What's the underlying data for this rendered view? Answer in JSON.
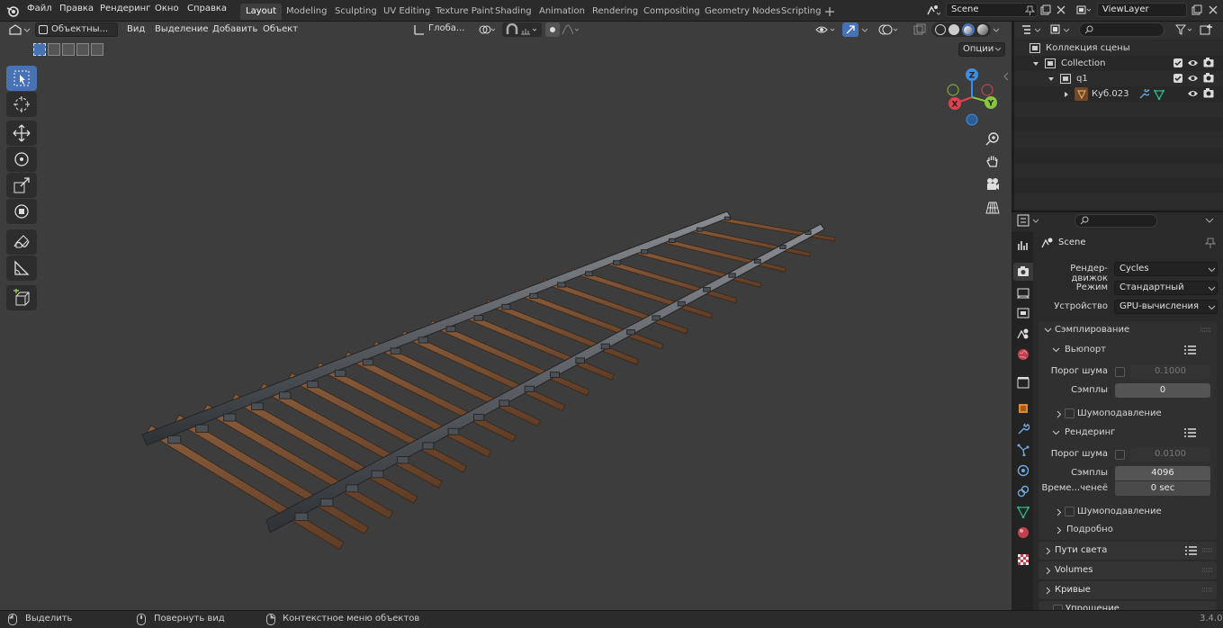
{
  "topbar": {
    "menus": [
      "Файл",
      "Правка",
      "Рендеринг",
      "Окно",
      "Справка"
    ],
    "workspaces": [
      "Layout",
      "Modeling",
      "Sculpting",
      "UV Editing",
      "Texture Paint",
      "Shading",
      "Animation",
      "Rendering",
      "Compositing",
      "Geometry Nodes",
      "Scripting"
    ],
    "active_workspace": "Layout",
    "scene": "Scene",
    "view_layer": "ViewLayer"
  },
  "viewport": {
    "mode": "Объектны...",
    "menus": [
      "Вид",
      "Выделение",
      "Добавить",
      "Объект"
    ],
    "orientation": "Глоба...",
    "options_label": "Опции",
    "gizmo_axes": [
      "X",
      "Y",
      "Z"
    ],
    "background_color": "#3d3d3d"
  },
  "outliner": {
    "search_placeholder": "",
    "rows": [
      {
        "label": "Коллекция сцены"
      },
      {
        "label": "Collection"
      },
      {
        "label": "q1"
      },
      {
        "label": "Куб.023"
      }
    ]
  },
  "properties": {
    "search_placeholder": "",
    "scene_name": "Scene",
    "render_engine_label": "Рендер-движок",
    "render_engine": "Cycles",
    "mode_label": "Режим",
    "mode": "Стандартный",
    "device_label": "Устройство",
    "device": "GPU-вычисления",
    "sampling": "Сэмплирование",
    "viewport_panel": "Вьюпорт",
    "vp_noise_label": "Порог шума",
    "vp_noise": "0.1000",
    "vp_samples_label": "Сэмплы",
    "vp_samples": "0",
    "vp_denoise": "Шумоподавление",
    "render_panel": "Рендеринг",
    "r_noise_label": "Порог шума",
    "r_noise": "0.0100",
    "r_samples_label": "Сэмплы",
    "r_samples": "4096",
    "r_time_label": "Време...ченеё",
    "r_time": "0 sec",
    "r_denoise": "Шумоподавление",
    "advanced": "Подробно",
    "light_paths": "Пути света",
    "volumes": "Volumes",
    "curves": "Кривые",
    "simplify": "Упрощение"
  },
  "status": {
    "select": "Выделить",
    "rotate": "Повернуть вид",
    "context": "Контекстное меню объектов",
    "version": "3.4.0"
  },
  "colors": {
    "accent": "#4772b3",
    "x_axis": "#e0434f",
    "y_axis": "#8bc53f",
    "z_axis": "#3d8ee0"
  }
}
